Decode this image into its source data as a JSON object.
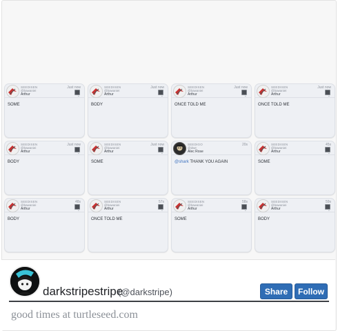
{
  "feed": {
    "cards": [
      {
        "brand": "SEEDISEN",
        "at": "@bawaniei",
        "author": "Arthur",
        "time": "Just now",
        "message": "SOME",
        "avatar": "red"
      },
      {
        "brand": "SEEDISEN",
        "at": "@bawaniei",
        "author": "Arthur",
        "time": "Just now",
        "message": "BODY",
        "avatar": "red"
      },
      {
        "brand": "SEEDISEN",
        "at": "@bawaniei",
        "author": "Arthur",
        "time": "Just now",
        "message": "ONCE TOLD ME",
        "avatar": "red"
      },
      {
        "brand": "SEEDISEN",
        "at": "@bawaniei",
        "author": "Arthur",
        "time": "Just now",
        "message": "ONCE TOLD ME",
        "avatar": "red"
      },
      {
        "brand": "SEEDISEN",
        "at": "@bawaniei",
        "author": "Arthur",
        "time": "Just now",
        "message": "BODY",
        "avatar": "red"
      },
      {
        "brand": "SEEDISEN",
        "at": "@bawaniei",
        "author": "Arthur",
        "time": "Just now",
        "message": "SOME",
        "avatar": "red"
      },
      {
        "brand": "SEEDIGO",
        "at": "@dwe",
        "author": "Alec Rose",
        "time": "20s",
        "mention": "@shark",
        "message": " THANK YOU AGAIN",
        "avatar": "dark"
      },
      {
        "brand": "SEEDISEN",
        "at": "@bawaniei",
        "author": "Arthur",
        "time": "45s",
        "message": "SOME",
        "avatar": "red"
      },
      {
        "brand": "SEEDISEN",
        "at": "@bawaniei",
        "author": "Arthur",
        "time": "48s",
        "message": "BODY",
        "avatar": "red"
      },
      {
        "brand": "SEEDISEN",
        "at": "@bawaniei",
        "author": "Arthur",
        "time": "57s",
        "message": "ONCE TOLD ME",
        "avatar": "red"
      },
      {
        "brand": "SEEDISEN",
        "at": "@bawaniei",
        "author": "Arthur",
        "time": "58s",
        "message": "SOME",
        "avatar": "red"
      },
      {
        "brand": "SEEDISEN",
        "at": "@bawaniei",
        "author": "Arthur",
        "time": "59s",
        "message": "BODY",
        "avatar": "red"
      }
    ]
  },
  "profile": {
    "display_name": "darkstripestripe",
    "handle": "(@darkstripe)",
    "share_label": "Share",
    "follow_label": "Follow",
    "tagline": "good times at turtleseed.com"
  },
  "colors": {
    "accent": "#2f6db5",
    "card_bg": "#eef0f4",
    "mention": "#3f73c0"
  }
}
